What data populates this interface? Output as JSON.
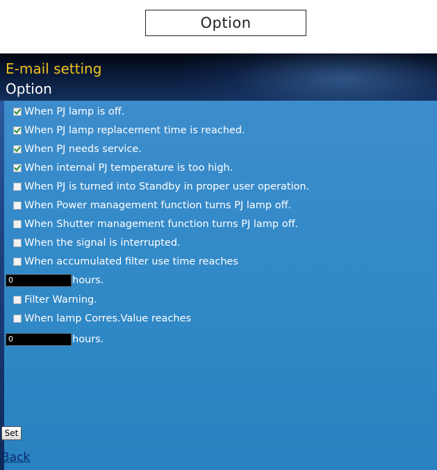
{
  "top_label": "Option",
  "header": {
    "title": "E-mail setting",
    "subtitle": "Option"
  },
  "options": [
    {
      "label": "When PJ lamp is off.",
      "checked": true
    },
    {
      "label": "When PJ lamp replacement time is reached.",
      "checked": true
    },
    {
      "label": "When PJ needs service.",
      "checked": true
    },
    {
      "label": "When internal PJ temperature is too high.",
      "checked": true
    },
    {
      "label": "When PJ is turned into Standby in proper user operation.",
      "checked": false
    },
    {
      "label": "When Power management function turns PJ lamp off.",
      "checked": false
    },
    {
      "label": "When Shutter management function turns PJ lamp off.",
      "checked": false
    },
    {
      "label": "When the signal is interrupted.",
      "checked": false
    },
    {
      "label": "When accumulated filter use time reaches",
      "checked": false
    }
  ],
  "filter_hours": {
    "value": "0",
    "unit": "hours."
  },
  "filter_warning": {
    "label": "Filter Warning.",
    "checked": false
  },
  "lamp_option": {
    "label": "When lamp Corres.Value reaches",
    "checked": false
  },
  "lamp_hours": {
    "value": "0",
    "unit": "hours."
  },
  "set_label": "Set",
  "back_label": "Back",
  "colors": {
    "title": "#f0c020",
    "content_bg": "#338ac8",
    "header_bg": "#0a1a38"
  }
}
